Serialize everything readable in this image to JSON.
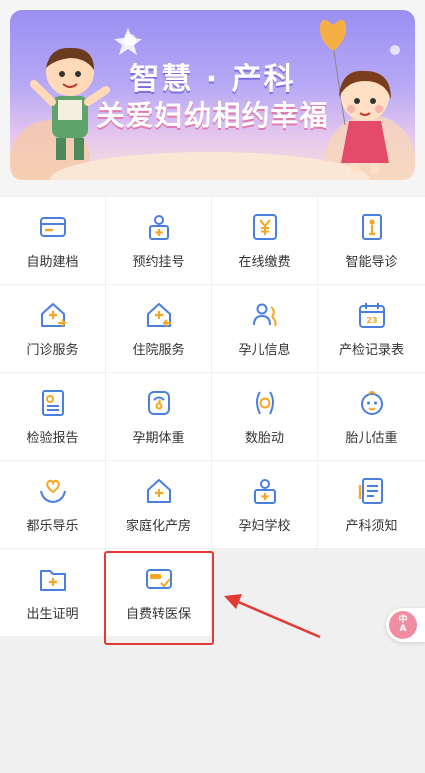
{
  "banner": {
    "title_line1": "智慧 · 产科",
    "title_line2": "关爱妇幼相约幸福"
  },
  "menu": [
    {
      "label": "自助建档",
      "icon": "card-icon"
    },
    {
      "label": "预约挂号",
      "icon": "person-plus-icon"
    },
    {
      "label": "在线缴费",
      "icon": "yen-icon"
    },
    {
      "label": "智能导诊",
      "icon": "guide-person-icon"
    },
    {
      "label": "门诊服务",
      "icon": "clinic-house-icon"
    },
    {
      "label": "住院服务",
      "icon": "hospital-house-icon"
    },
    {
      "label": "孕儿信息",
      "icon": "mother-baby-icon"
    },
    {
      "label": "产检记录表",
      "icon": "calendar-icon"
    },
    {
      "label": "检验报告",
      "icon": "report-icon"
    },
    {
      "label": "孕期体重",
      "icon": "scale-icon"
    },
    {
      "label": "数胎动",
      "icon": "fetal-movement-icon"
    },
    {
      "label": "胎儿估重",
      "icon": "baby-face-icon"
    },
    {
      "label": "都乐导乐",
      "icon": "heart-hands-icon"
    },
    {
      "label": "家庭化产房",
      "icon": "home-plus-icon"
    },
    {
      "label": "孕妇学校",
      "icon": "school-icon"
    },
    {
      "label": "产科须知",
      "icon": "notice-doc-icon"
    },
    {
      "label": "出生证明",
      "icon": "certificate-folder-icon"
    },
    {
      "label": "自费转医保",
      "icon": "insurance-card-icon"
    }
  ],
  "float_button": {
    "text_top": "中",
    "text_bottom": "A"
  },
  "colors": {
    "icon_blue": "#4a7fe0",
    "icon_orange": "#f5a623",
    "highlight_red": "#e53935"
  }
}
